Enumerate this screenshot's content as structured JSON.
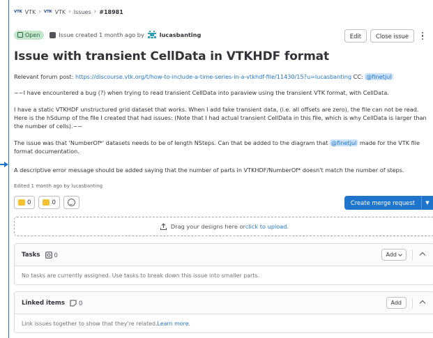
{
  "breadcrumb": {
    "logo_text": "VTK",
    "items": [
      "VTK",
      "VTK",
      "Issues",
      "#18981"
    ]
  },
  "issue": {
    "status": "Open",
    "created_text": "Issue created 1 month ago by",
    "author": "lucasbanting",
    "title": "Issue with transient CellData in VTKHDF format",
    "actions": {
      "edit": "Edit",
      "close": "Close issue"
    }
  },
  "description": {
    "p1_prefix": "Relevant forum post: ",
    "p1_link": "https://discourse.vtk.org/t/how-to-include-a-time-series-in-a-vtkhdf-file/11430/15?u=lucasbanting",
    "p1_cc": " CC: ",
    "p1_mention": "@finetjul",
    "p2": "~~I have encountered a bug (?) when trying to read transient CellData into paraview using the transient VTK format, with CellData.",
    "p3": "I have a static VTKHDF unstructured grid dataset that works. When I add fake transient data, (i.e. all offsets are zero), the file can not be read. Here is the hSdump of the file I created that had issues: (Note that I had actual transient CellData in this file, which is why CellData is larger than the number of cells).~~",
    "p4_prefix": "The issue was that 'NumberOf*' datasets needs to be of length NSteps. Can that be added to the diagram that ",
    "p4_mention": "@finetjul",
    "p4_suffix": " made for the VTK file format documentation.",
    "p5": "A descriptive error message should be added saying that the number of parts in VTKHDF/NumberOf* doesn't match the number of steps."
  },
  "edited": "Edited 1 month ago by lucasbanting",
  "reactions": {
    "thumbs_up": "0",
    "thumbs_down": "0"
  },
  "merge_request": {
    "label": "Create merge request"
  },
  "dropzone": {
    "prefix": "Drag your designs here or ",
    "link": "click to upload."
  },
  "tasks": {
    "title": "Tasks",
    "count": "0",
    "add": "Add",
    "empty": "No tasks are currently assigned. Use tasks to break down this issue into smaller parts."
  },
  "linked": {
    "title": "Linked items",
    "count": "0",
    "add": "Add",
    "empty_prefix": "Link issues together to show that they're related. ",
    "empty_link": "Learn more."
  },
  "colors": {
    "accent": "#1f75cb",
    "open_badge_bg": "#c3e6cd",
    "open_badge_text": "#24663b",
    "mention_bg": "#cbe2f9"
  },
  "icons": [
    "vtk-logo",
    "issue-open-icon",
    "issue-type-icon",
    "author-avatar",
    "kebab-icon",
    "thumbs-up-icon",
    "thumbs-down-icon",
    "emoji-picker-icon",
    "chevron-down-icon",
    "upload-icon",
    "tasks-icon",
    "linked-items-icon",
    "chevron-up-icon"
  ]
}
